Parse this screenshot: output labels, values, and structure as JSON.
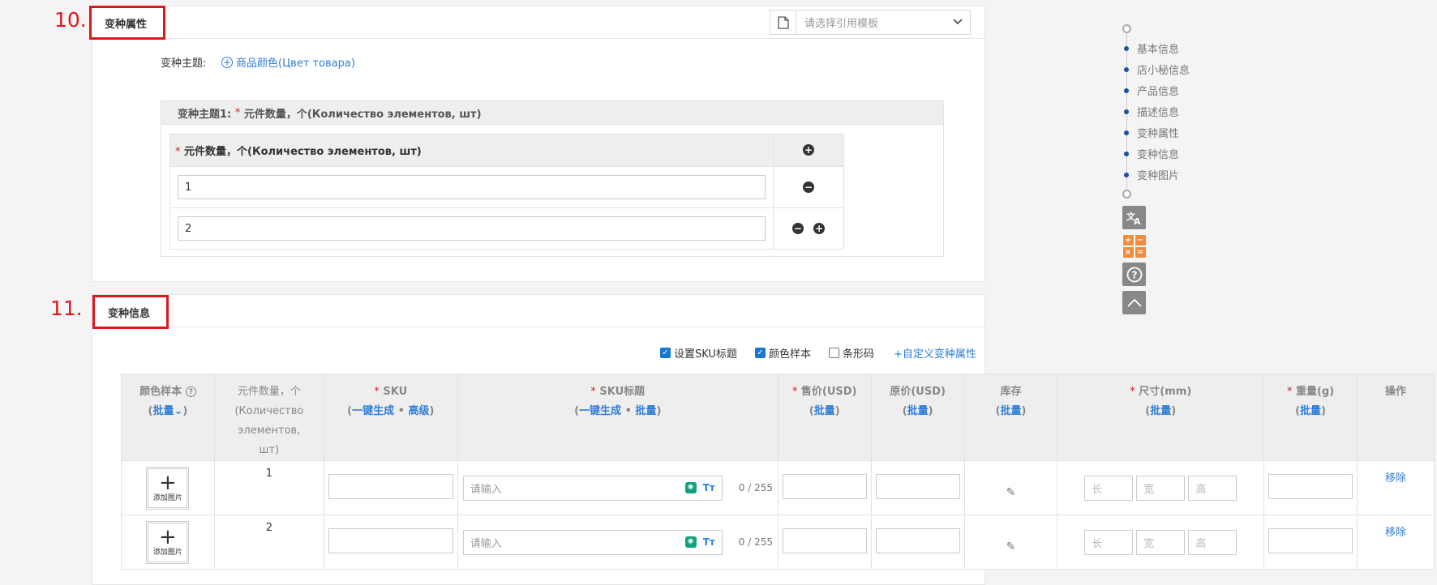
{
  "section10": {
    "num": "10.",
    "title": "变种属性",
    "template_placeholder": "请选择引用模板",
    "theme_label": "变种主题:",
    "theme_link": "商品颜色(Цвет товара)",
    "theme1_header_prefix": "变种主题1:",
    "theme1_header_req": "*",
    "theme1_header_name": "元件数量，个(Количество элементов, шт)",
    "attr_col_req": "*",
    "attr_col_name": "元件数量，个(Количество элементов, шт)",
    "values": [
      "1",
      "2"
    ]
  },
  "nav": {
    "items": [
      "基本信息",
      "店小秘信息",
      "产品信息",
      "描述信息",
      "变种属性",
      "变种信息",
      "变种图片"
    ]
  },
  "tools": [
    "translate-icon",
    "calculator-icon",
    "help-icon",
    "back-to-top-icon"
  ],
  "section11": {
    "num": "11.",
    "title": "变种信息",
    "options": [
      {
        "label": "设置SKU标题",
        "checked": true
      },
      {
        "label": "颜色样本",
        "checked": true
      },
      {
        "label": "条形码",
        "checked": false
      }
    ],
    "custom_link": "+自定义变种属性",
    "headers": {
      "color_sample": "颜色样本",
      "color_batch": "批量",
      "qty": "元件数量，个(Количество элементов, шт)",
      "sku": "SKU",
      "sku_gen": "一键生成",
      "sku_adv": "高级",
      "sku_title": "SKU标题",
      "sku_title_gen": "一键生成",
      "sku_title_batch": "批量",
      "price": "售价(USD)",
      "orig_price": "原价(USD)",
      "stock": "库存",
      "size": "尺寸(mm)",
      "weight": "重量(g)",
      "batch": "批量",
      "action": "操作"
    },
    "rows": [
      {
        "qty": "1",
        "title_placeholder": "请输入",
        "count": "0 / 255",
        "len": "长",
        "wid": "宽",
        "hei": "高",
        "remove": "移除",
        "add_image": "添加图片"
      },
      {
        "qty": "2",
        "title_placeholder": "请输入",
        "count": "0 / 255",
        "len": "长",
        "wid": "宽",
        "hei": "高",
        "remove": "移除",
        "add_image": "添加图片"
      }
    ]
  }
}
